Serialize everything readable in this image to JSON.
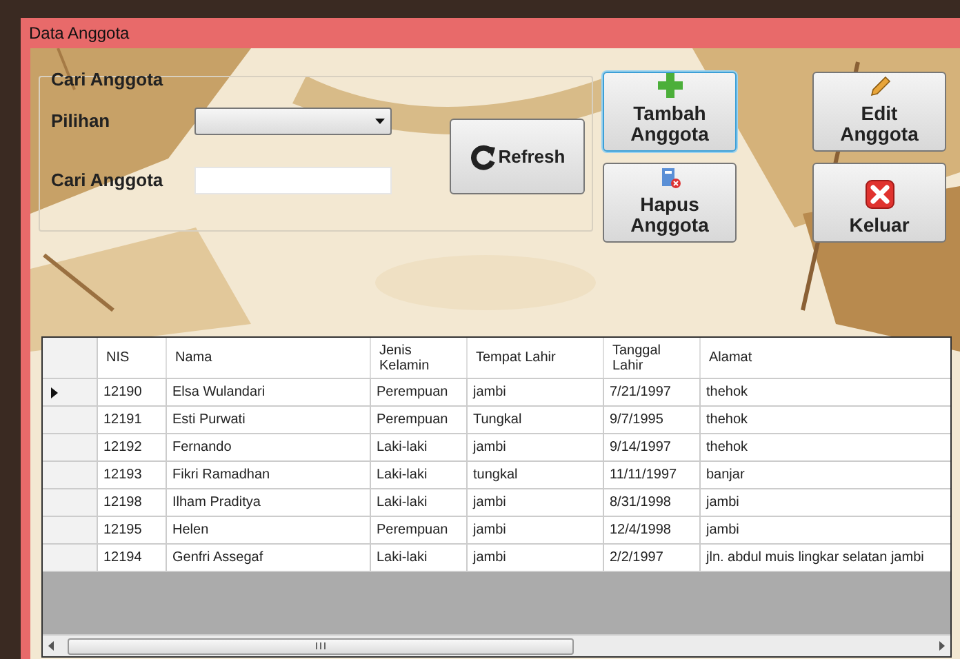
{
  "window": {
    "title": "Data Anggota"
  },
  "search_group": {
    "title": "Cari Anggota",
    "choice_label": "Pilihan",
    "search_label": "Cari Anggota",
    "refresh": "Refresh"
  },
  "buttons": [
    {
      "label": "Tambah Anggota",
      "kind": "add",
      "focused": true
    },
    {
      "label": "Edit Anggota",
      "kind": "edit",
      "focused": false
    },
    {
      "label": "Hapus Anggota",
      "kind": "delete",
      "focused": false
    },
    {
      "label": "Keluar",
      "kind": "exit",
      "focused": false
    }
  ],
  "table": {
    "columns": [
      "NIS",
      "Nama",
      "Jenis Kelamin",
      "Tempat Lahir",
      "Tanggal Lahir",
      "Alamat"
    ],
    "rows": [
      {
        "cells": [
          "12190",
          "Elsa Wulandari",
          "Perempuan",
          "jambi",
          "7/21/1997",
          "thehok"
        ],
        "current": true
      },
      {
        "cells": [
          "12191",
          "Esti Purwati",
          "Perempuan",
          "Tungkal",
          "9/7/1995",
          "thehok"
        ],
        "current": false
      },
      {
        "cells": [
          "12192",
          "Fernando",
          "Laki-laki",
          "jambi",
          "9/14/1997",
          "thehok"
        ],
        "current": false
      },
      {
        "cells": [
          "12193",
          "Fikri Ramadhan",
          "Laki-laki",
          "tungkal",
          "11/11/1997",
          "banjar"
        ],
        "current": false
      },
      {
        "cells": [
          "12198",
          "Ilham Praditya",
          "Laki-laki",
          "jambi",
          "8/31/1998",
          "jambi"
        ],
        "current": false
      },
      {
        "cells": [
          "12195",
          "Helen",
          "Perempuan",
          "jambi",
          "12/4/1998",
          "jambi"
        ],
        "current": false
      },
      {
        "cells": [
          "12194",
          "Genfri Assegaf",
          "Laki-laki",
          "jambi",
          "2/2/1997",
          "jln. abdul muis lingkar selatan jambi"
        ],
        "current": false
      }
    ]
  }
}
